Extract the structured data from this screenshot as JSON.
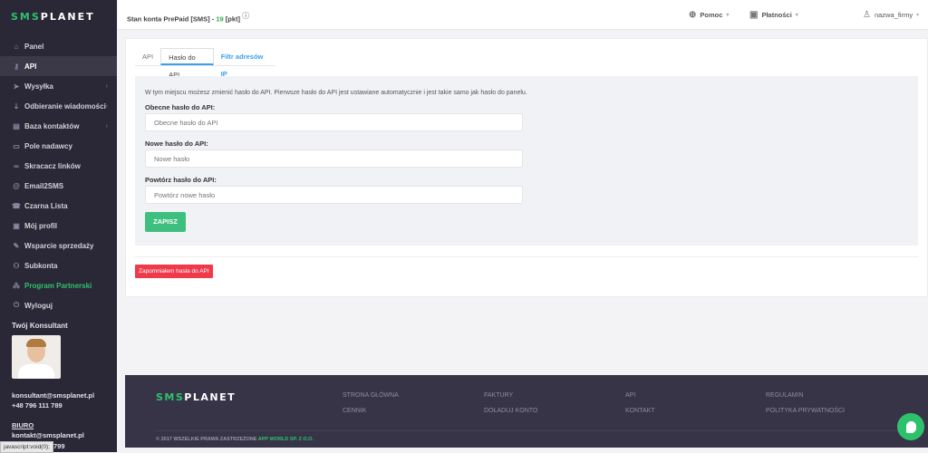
{
  "brand": {
    "logo_green": "SMS",
    "logo_white": "PLANET"
  },
  "sidebar": {
    "items": [
      {
        "label": "Panel",
        "icon": "home-icon",
        "glyph": "⌂"
      },
      {
        "label": "API",
        "icon": "key-icon",
        "glyph": "⚷",
        "active": true
      },
      {
        "label": "Wysyłka",
        "icon": "send-icon",
        "glyph": "➤",
        "submenu": true
      },
      {
        "label": "Odbieranie wiadomości",
        "icon": "download-icon",
        "glyph": "⇣",
        "submenu": true
      },
      {
        "label": "Baza kontaktów",
        "icon": "contacts-icon",
        "glyph": "▤",
        "submenu": true
      },
      {
        "label": "Pole nadawcy",
        "icon": "id-card-icon",
        "glyph": "▭"
      },
      {
        "label": "Skracacz linków",
        "icon": "link-icon",
        "glyph": "∞"
      },
      {
        "label": "Email2SMS",
        "icon": "at-icon",
        "glyph": "@"
      },
      {
        "label": "Czarna Lista",
        "icon": "phone-block-icon",
        "glyph": "☎"
      },
      {
        "label": "Mój profil",
        "icon": "profile-icon",
        "glyph": "▣"
      },
      {
        "label": "Wsparcie sprzedaży",
        "icon": "rocket-icon",
        "glyph": "✎"
      },
      {
        "label": "Subkonta",
        "icon": "users-icon",
        "glyph": "⚇"
      },
      {
        "label": "Program Partnerski",
        "icon": "network-icon",
        "glyph": "⁂",
        "highlight": true
      },
      {
        "label": "Wyloguj",
        "icon": "power-icon",
        "glyph": "⏻"
      }
    ],
    "consultant_title": "Twój Konsultant",
    "consultant_email": "konsultant@smsplanet.pl",
    "consultant_phone": "+48 796 111 789",
    "office_label": "BIURO",
    "office_email": "kontakt@smsplanet.pl",
    "office_phone": "799"
  },
  "status_bar": "javascript:void(0);",
  "topbar": {
    "balance_label": "Stan konta PrePaid [SMS] - ",
    "balance_value": "19",
    "balance_unit": " [pkt]",
    "info_glyph": "ⓘ",
    "help": "Pomoc",
    "payments": "Płatności",
    "user": "nazwa_firmy",
    "caret": "▾"
  },
  "tabs": [
    {
      "label": "API"
    },
    {
      "label": "Hasło do API",
      "active": true
    },
    {
      "label": "Filtr adresów IP"
    }
  ],
  "form": {
    "description": "W tym miejscu możesz zmienić hasło do API. Pierwsze hasło do API jest ustawiane automatycznie i jest takie samo jak hasło do panelu.",
    "current_label": "Obecne hasło do API:",
    "current_placeholder": "Obecne hasło do API",
    "new_label": "Nowe hasło do API:",
    "new_placeholder": "Nowe hasło",
    "repeat_label": "Powtórz hasło do API:",
    "repeat_placeholder": "Powtórz nowe hasło",
    "save": "ZAPISZ",
    "forgot": "Zapomniałem hasła do API"
  },
  "footer": {
    "links": [
      [
        "STRONA GŁÓWNA",
        "CENNIK"
      ],
      [
        "FAKTURY",
        "DOŁADUJ KONTO"
      ],
      [
        "API",
        "KONTAKT"
      ],
      [
        "REGULAMIN",
        "POLITYKA PRYWATNOŚCI"
      ]
    ],
    "copyright": "© 2017 WSZELKIE PRAWA ZASTRZEŻONE ",
    "company": "APP WORLD SP. Z O.O."
  },
  "colors": {
    "accent": "#2ec16b",
    "sidebar": "#2a2837",
    "danger": "#f03a4a",
    "link": "#3aa0f0"
  }
}
